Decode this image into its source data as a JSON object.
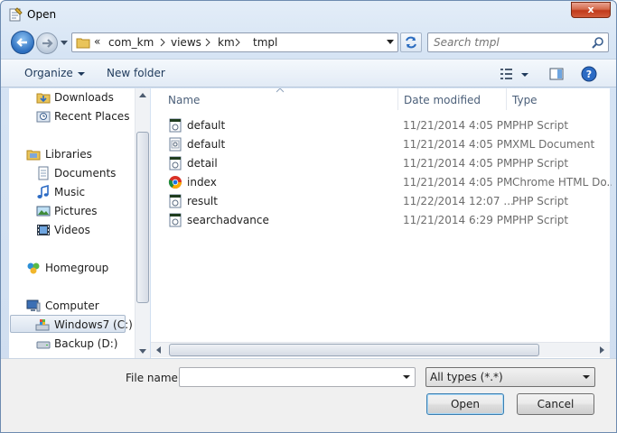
{
  "window": {
    "title": "Open",
    "close_label": "x"
  },
  "address": {
    "overflow": "«",
    "crumbs": [
      "com_km",
      "views",
      "km",
      "tmpl"
    ]
  },
  "search": {
    "placeholder": "Search tmpl"
  },
  "toolbar": {
    "organize": "Organize",
    "new_folder": "New folder"
  },
  "nav": {
    "items": [
      {
        "label": "Downloads",
        "icon": "downloads-icon"
      },
      {
        "label": "Recent Places",
        "icon": "recent-places-icon"
      },
      {
        "label": "Libraries",
        "icon": "libraries-icon"
      },
      {
        "label": "Documents",
        "icon": "documents-icon"
      },
      {
        "label": "Music",
        "icon": "music-icon"
      },
      {
        "label": "Pictures",
        "icon": "pictures-icon"
      },
      {
        "label": "Videos",
        "icon": "videos-icon"
      },
      {
        "label": "Homegroup",
        "icon": "homegroup-icon"
      },
      {
        "label": "Computer",
        "icon": "computer-icon"
      },
      {
        "label": "Windows7 (C:)",
        "icon": "drive-c-icon"
      },
      {
        "label": "Backup (D:)",
        "icon": "drive-d-icon"
      }
    ]
  },
  "columns": {
    "name": "Name",
    "date": "Date modified",
    "type": "Type"
  },
  "files": [
    {
      "name": "default",
      "date": "11/21/2014 4:05 PM",
      "type": "PHP Script",
      "icon": "php-file-icon"
    },
    {
      "name": "default",
      "date": "11/21/2014 4:05 PM",
      "type": "XML Document",
      "icon": "xml-file-icon"
    },
    {
      "name": "detail",
      "date": "11/21/2014 4:05 PM",
      "type": "PHP Script",
      "icon": "php-file-icon"
    },
    {
      "name": "index",
      "date": "11/21/2014 4:05 PM",
      "type": "Chrome HTML Do...",
      "icon": "chrome-html-icon"
    },
    {
      "name": "result",
      "date": "11/22/2014 12:07 ...",
      "type": "PHP Script",
      "icon": "php-file-icon"
    },
    {
      "name": "searchadvance",
      "date": "11/21/2014 6:29 PM",
      "type": "PHP Script",
      "icon": "php-file-icon"
    }
  ],
  "bottom": {
    "filename_label": "File name:",
    "filename_value": "",
    "filter": "All types (*.*)",
    "open": "Open",
    "cancel": "Cancel"
  }
}
